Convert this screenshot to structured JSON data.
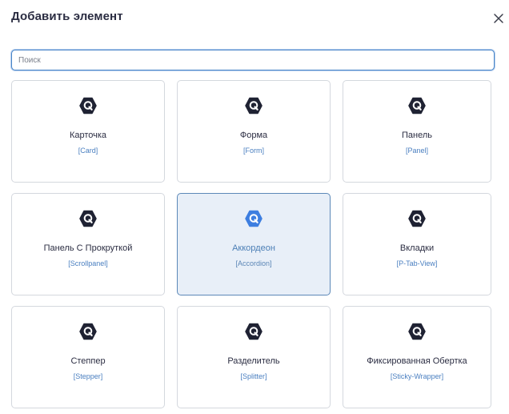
{
  "dialog": {
    "title": "Добавить элемент",
    "close_icon": "close-icon"
  },
  "search": {
    "placeholder": "Поиск",
    "value": ""
  },
  "colors": {
    "icon_default": "#1f2233",
    "icon_selected": "#3d7ee0",
    "accent": "#4a86c8",
    "selected_bg": "#e8eff8"
  },
  "items": [
    {
      "name": "Карточка",
      "tag": "[Card]",
      "icon": "hexagon-q-icon",
      "selected": false
    },
    {
      "name": "Форма",
      "tag": "[Form]",
      "icon": "hexagon-q-icon",
      "selected": false
    },
    {
      "name": "Панель",
      "tag": "[Panel]",
      "icon": "hexagon-q-icon",
      "selected": false
    },
    {
      "name": "Панель С Прокруткой",
      "tag": "[Scrollpanel]",
      "icon": "hexagon-q-icon",
      "selected": false
    },
    {
      "name": "Аккордеон",
      "tag": "[Accordion]",
      "icon": "hexagon-q-icon",
      "selected": true
    },
    {
      "name": "Вкладки",
      "tag": "[P-Tab-View]",
      "icon": "hexagon-q-icon",
      "selected": false
    },
    {
      "name": "Степпер",
      "tag": "[Stepper]",
      "icon": "hexagon-q-icon",
      "selected": false
    },
    {
      "name": "Разделитель",
      "tag": "[Splitter]",
      "icon": "hexagon-q-icon",
      "selected": false
    },
    {
      "name": "Фиксированная Обертка",
      "tag": "[Sticky-Wrapper]",
      "icon": "hexagon-q-icon",
      "selected": false
    }
  ]
}
